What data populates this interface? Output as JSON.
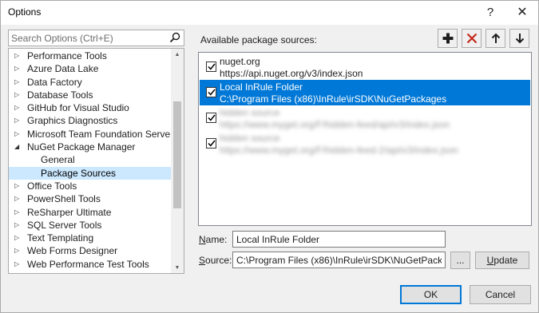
{
  "window": {
    "title": "Options",
    "help_glyph": "?",
    "close_glyph": "✕"
  },
  "search": {
    "placeholder": "Search Options (Ctrl+E)"
  },
  "tree": {
    "items": [
      {
        "label": "Performance Tools",
        "arrow": "▷"
      },
      {
        "label": "Azure Data Lake",
        "arrow": "▷"
      },
      {
        "label": "Data Factory",
        "arrow": "▷"
      },
      {
        "label": "Database Tools",
        "arrow": "▷"
      },
      {
        "label": "GitHub for Visual Studio",
        "arrow": "▷"
      },
      {
        "label": "Graphics Diagnostics",
        "arrow": "▷"
      },
      {
        "label": "Microsoft Team Foundation Server 20",
        "arrow": "▷"
      },
      {
        "label": "NuGet Package Manager",
        "arrow": "◢"
      },
      {
        "label": "General",
        "arrow": ""
      },
      {
        "label": "Package Sources",
        "arrow": ""
      },
      {
        "label": "Office Tools",
        "arrow": "▷"
      },
      {
        "label": "PowerShell Tools",
        "arrow": "▷"
      },
      {
        "label": "ReSharper Ultimate",
        "arrow": "▷"
      },
      {
        "label": "SQL Server Tools",
        "arrow": "▷"
      },
      {
        "label": "Text Templating",
        "arrow": "▷"
      },
      {
        "label": "Web Forms Designer",
        "arrow": "▷"
      },
      {
        "label": "Web Performance Test Tools",
        "arrow": "▷"
      }
    ]
  },
  "sources": {
    "heading": "Available package sources:",
    "items": [
      {
        "name": "nuget.org",
        "url": "https://api.nuget.org/v3/index.json",
        "checked": true
      },
      {
        "name": "Local InRule Folder",
        "url": "C:\\Program Files (x86)\\InRule\\irSDK\\NuGetPackages",
        "checked": true
      },
      {
        "name": "hidden source",
        "url": "https://www.myget.org/F/hidden-feed/api/v3/index.json",
        "checked": true
      },
      {
        "name": "hidden source",
        "url": "https://www.myget.org/F/hidden-feed-2/api/v3/index.json",
        "checked": true
      }
    ]
  },
  "form": {
    "name_label_key": "N",
    "name_label_rest": "ame:",
    "name_value": "Local InRule Folder",
    "source_label_key": "S",
    "source_label_rest": "ource:",
    "source_value": "C:\\Program Files (x86)\\InRule\\irSDK\\NuGetPackages",
    "browse_label": "...",
    "update_label_key": "U",
    "update_label_rest": "pdate"
  },
  "footer": {
    "ok_label": "OK",
    "cancel_label": "Cancel"
  },
  "colors": {
    "selection": "#0078d7",
    "tree_selection": "#cce8ff",
    "remove_red": "#c42b1c"
  }
}
